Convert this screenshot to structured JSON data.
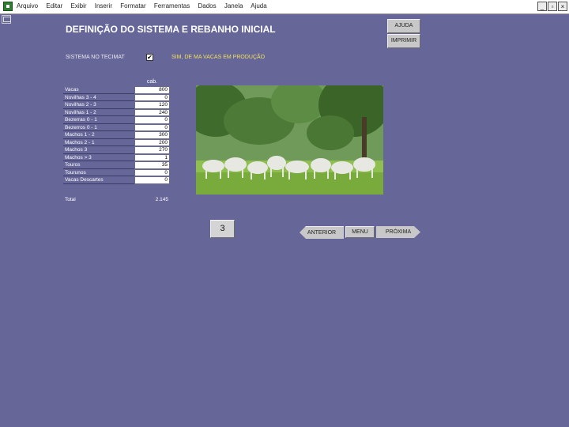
{
  "menu": {
    "items": [
      "Arquivo",
      "Editar",
      "Exibir",
      "Inserir",
      "Formatar",
      "Ferramentas",
      "Dados",
      "Janela",
      "Ajuda"
    ]
  },
  "window_controls": {
    "minimize": "_",
    "restore": "▫",
    "close": "×"
  },
  "page": {
    "title": "DEFINIÇÃO DO SISTEMA E REBANHO INICIAL",
    "sistema_label": "SISTEMA NO TECIMAT",
    "sistema_checked": true,
    "sim_label": "SIM, DE MA VACAS EM PRODUÇÃO"
  },
  "buttons": {
    "ajuda": "AJUDA",
    "imprimir": "IMPRIMIR",
    "anterior": "ANTERIOR",
    "menu": "MENU",
    "proxima": "PRÓXIMA"
  },
  "table": {
    "column_header": "cab.",
    "rows": [
      {
        "label": "Vacas",
        "value": "800"
      },
      {
        "label": "Novilhas 3 - 4",
        "value": "0"
      },
      {
        "label": "Novilhas 2 - 3",
        "value": "120"
      },
      {
        "label": "Novilhas 1 - 2",
        "value": "240"
      },
      {
        "label": "Bezerras 0 - 1",
        "value": "0"
      },
      {
        "label": "Bezerros 0 - 1",
        "value": "0"
      },
      {
        "label": "Machos 1 - 2",
        "value": "300"
      },
      {
        "label": "Machos 2 - 1",
        "value": "200"
      },
      {
        "label": "Machos 3",
        "value": "270"
      },
      {
        "label": "Machos > 3",
        "value": "1"
      },
      {
        "label": "Touros",
        "value": "35"
      },
      {
        "label": "Tourunos",
        "value": "0"
      },
      {
        "label": "Vacas Descartes",
        "value": "0"
      }
    ],
    "total_label": "Total",
    "total_value": "2.145"
  },
  "page_number": "3",
  "colors": {
    "background": "#666699",
    "highlight_text": "#f0e060"
  }
}
